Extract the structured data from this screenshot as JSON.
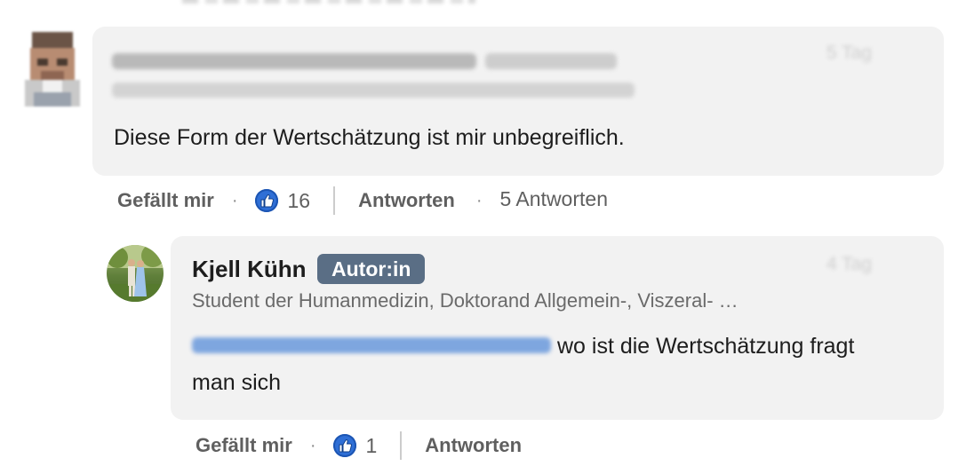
{
  "comment1": {
    "author": "Martin Werner • DoorsDeBwiss",
    "author_suffix": "(Herr) • 3.+",
    "headline": "Amt seit 1983 dein Leben genießen in der Schweiz.",
    "time": "5 Tag",
    "text": "Diese Form der Wertschätzung ist mir unbegreiflich.",
    "actions": {
      "like_label": "Gefällt mir",
      "like_count": "16",
      "reply_label": "Antworten",
      "replies_count": "5 Antworten"
    }
  },
  "comment2": {
    "author": "Kjell Kühn",
    "badge": "Autor:in",
    "headline": "Student der Humanmedizin, Doktorand Allgemein-, Viszeral- …",
    "time": "4 Tag",
    "mention": "Martin Werner • DoorsDeBwiss",
    "text": " wo ist die Wertschätzung fragt",
    "text_line2": "man sich",
    "actions": {
      "like_label": "Gefällt mir",
      "like_count": "1",
      "reply_label": "Antworten"
    }
  },
  "colors": {
    "bubble": "#f2f2f2",
    "badge": "#5a6e85",
    "like": "#2f6fd6",
    "mention": "#0a66c2"
  },
  "icons": [
    "like-reaction-icon",
    "avatar-photo"
  ]
}
